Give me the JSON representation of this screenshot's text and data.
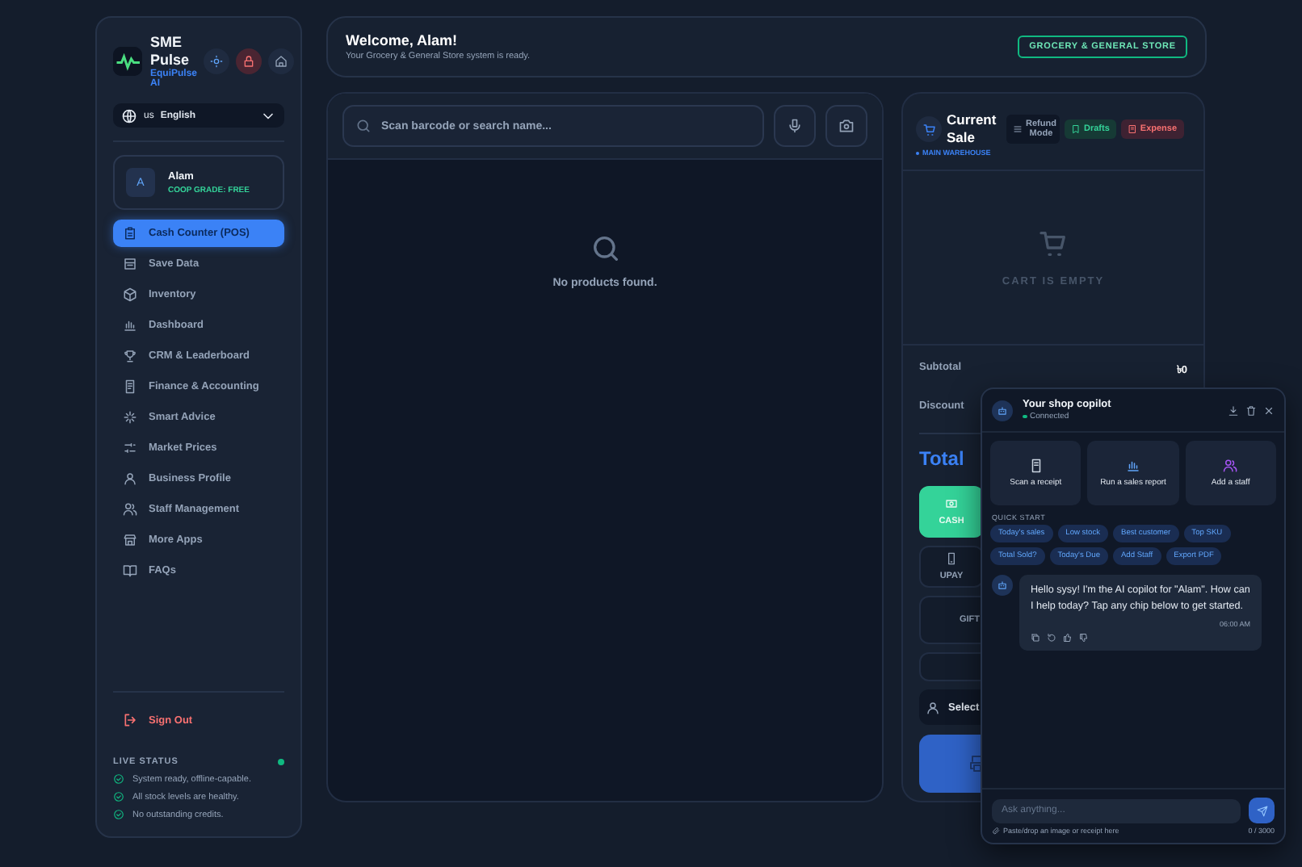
{
  "sidebar": {
    "brand": {
      "title": "SME Pulse",
      "subtitle": "EquiPulse AI"
    },
    "language": {
      "flag": "us",
      "label": "English"
    },
    "user": {
      "initial": "A",
      "name": "Alam",
      "grade": "COOP GRADE: FREE"
    },
    "nav": [
      {
        "label": "Cash Counter (POS)",
        "selected": true
      },
      {
        "label": "Save Data",
        "selected": false
      },
      {
        "label": "Inventory",
        "selected": false
      },
      {
        "label": "Dashboard",
        "selected": false
      },
      {
        "label": "CRM & Leaderboard",
        "selected": false
      },
      {
        "label": "Finance & Accounting",
        "selected": false
      },
      {
        "label": "Smart Advice",
        "selected": false
      },
      {
        "label": "Market Prices",
        "selected": false
      },
      {
        "label": "Business Profile",
        "selected": false
      },
      {
        "label": "Staff Management",
        "selected": false
      },
      {
        "label": "More Apps",
        "selected": false
      },
      {
        "label": "FAQs",
        "selected": false
      }
    ],
    "sign_out": "Sign Out",
    "live_status": {
      "title": "LIVE STATUS",
      "items": [
        "System ready, offline-capable.",
        "All stock levels are healthy.",
        "No outstanding credits."
      ]
    }
  },
  "header": {
    "title": "Welcome, Alam!",
    "subtitle": "Your Grocery & General Store system is ready.",
    "badge": "GROCERY & GENERAL STORE"
  },
  "products": {
    "search": {
      "placeholder": "Scan barcode or search name..."
    },
    "empty": "No products found."
  },
  "sale": {
    "title": "Current Sale",
    "location": "MAIN WAREHOUSE",
    "actions": [
      {
        "label": "Refund Mode",
        "kind": "neutral"
      },
      {
        "label": "Drafts",
        "kind": "success"
      },
      {
        "label": "Expense",
        "kind": "danger"
      }
    ],
    "empty": "CART IS EMPTY",
    "subtotal_label": "Subtotal",
    "subtotal": "৳0",
    "discount_label": "Discount",
    "total_label": "Total",
    "payments": [
      {
        "label": "CASH",
        "selected": true
      },
      {
        "label": "UPAY",
        "selected": false
      }
    ],
    "gift": "GIFT",
    "customer": "Select"
  },
  "copilot": {
    "title": "Your shop copilot",
    "status": "Connected",
    "actions": [
      "Scan a receipt",
      "Run a sales report",
      "Add a staff"
    ],
    "quick_start": "QUICK START",
    "chips": [
      "Today's sales",
      "Low stock",
      "Best customer",
      "Top SKU",
      "Total Sold?",
      "Today's Due",
      "Add Staff",
      "Export PDF"
    ],
    "message": {
      "text": "Hello sysy! I'm the AI copilot for \"Alam\". How can I help today? Tap any chip below to get started.",
      "time": "06:00 AM"
    },
    "input": {
      "placeholder": "Ask anything..."
    },
    "hint": "Paste/drop an image or receipt here",
    "counter": "0 / 3000"
  }
}
